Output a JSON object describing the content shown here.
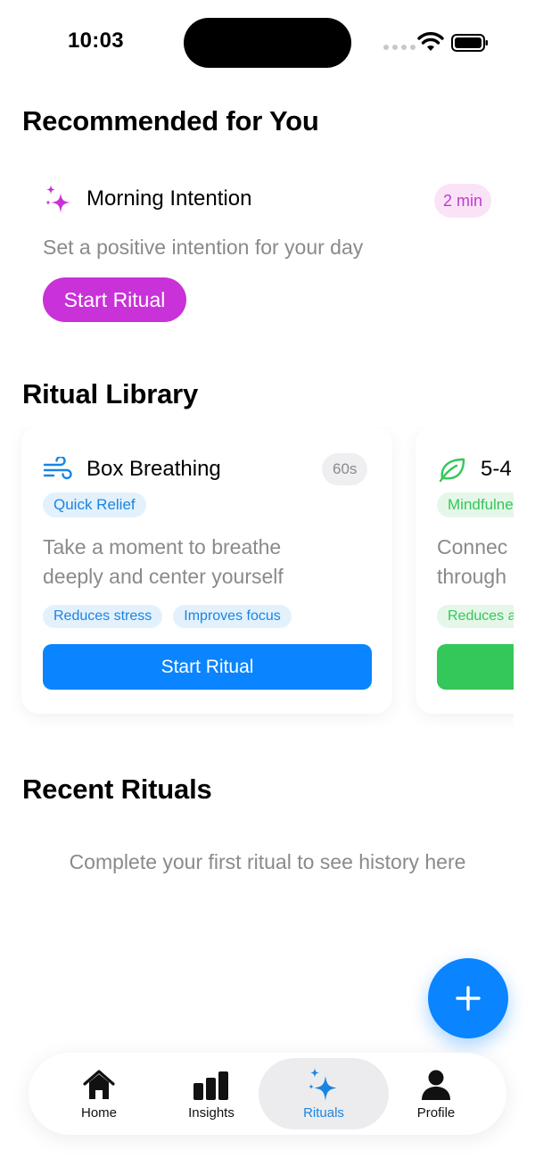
{
  "status_bar": {
    "time": "10:03"
  },
  "recommended": {
    "title": "Recommended for You",
    "card": {
      "title": "Morning Intention",
      "duration": "2 min",
      "description": "Set a positive intention for your day",
      "button": "Start Ritual",
      "icon": "sparkles-icon",
      "accent": "#c832d8"
    }
  },
  "library": {
    "title": "Ritual Library",
    "cards": [
      {
        "title": "Box Breathing",
        "duration": "60s",
        "category": "Quick Relief",
        "description_lines": [
          "Take a moment to breathe",
          "deeply and center yourself"
        ],
        "tags": [
          "Reduces stress",
          "Improves focus"
        ],
        "button": "Start Ritual",
        "icon": "wind-icon",
        "accent": "#0a84ff"
      },
      {
        "title": "5-4",
        "category": "Mindfulne",
        "description_lines": [
          "Connec",
          "through"
        ],
        "tags": [
          "Reduces a"
        ],
        "icon": "leaf-icon",
        "accent": "#34c759"
      }
    ]
  },
  "recent": {
    "title": "Recent Rituals",
    "empty_message": "Complete your first ritual to see history here"
  },
  "fab": {
    "icon": "plus-icon"
  },
  "tabbar": {
    "tabs": [
      {
        "label": "Home",
        "icon": "house-icon",
        "active": false
      },
      {
        "label": "Insights",
        "icon": "bar-chart-icon",
        "active": false
      },
      {
        "label": "Rituals",
        "icon": "sparkles-icon",
        "active": true
      },
      {
        "label": "Profile",
        "icon": "person-icon",
        "active": false
      }
    ]
  }
}
